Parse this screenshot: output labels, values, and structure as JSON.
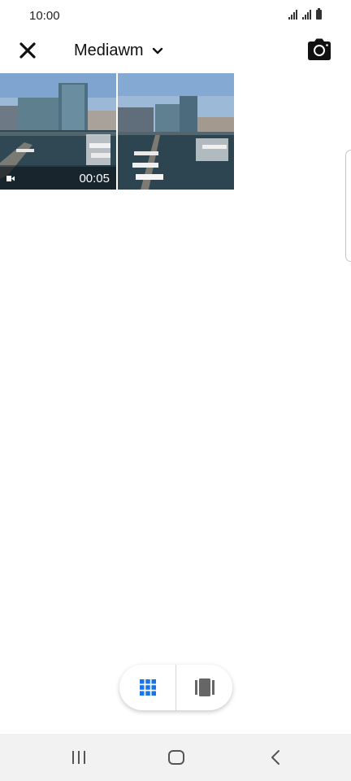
{
  "status": {
    "time": "10:00"
  },
  "header": {
    "album_title": "Mediawm",
    "close_icon": "close-icon",
    "dropdown_icon": "chevron-down-icon",
    "camera_icon": "camera-icon"
  },
  "gallery": {
    "items": [
      {
        "type": "video",
        "duration": "00:05"
      },
      {
        "type": "photo"
      }
    ]
  },
  "view_toggle": {
    "grid_icon": "grid-view-icon",
    "single_icon": "single-view-icon",
    "active": "grid",
    "active_color": "#1a73e8"
  },
  "nav": {
    "recents_icon": "recents-icon",
    "home_icon": "home-icon",
    "back_icon": "back-icon"
  }
}
